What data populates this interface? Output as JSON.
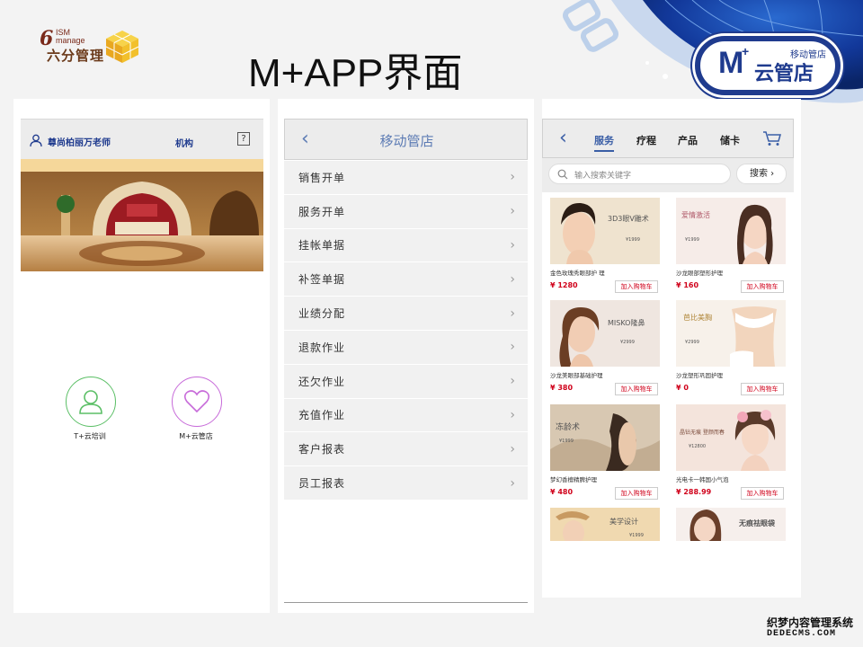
{
  "slide": {
    "title": "M+APP界面",
    "brand": {
      "six": "6",
      "ism": "ISM",
      "manage": "manage",
      "cn": "六分管理"
    },
    "logo": {
      "mark": "M",
      "small": "移动管店",
      "big": "云管店"
    }
  },
  "panel1": {
    "user": "尊尚柏丽万老师",
    "org": "机构",
    "help": "?",
    "apps": [
      {
        "label": "T+云培训",
        "color": "#5bbf66",
        "icon": "person-icon"
      },
      {
        "label": "M+云管店",
        "color": "#c76ad9",
        "icon": "heart-icon"
      }
    ]
  },
  "panel2": {
    "back": "‹",
    "title": "移动管店",
    "menu": [
      "销售开单",
      "服务开单",
      "挂帐单据",
      "补签单据",
      "业绩分配",
      "退款作业",
      "还欠作业",
      "充值作业",
      "客户报表",
      "员工报表"
    ],
    "chevron": "›"
  },
  "panel3": {
    "back": "‹",
    "tabs": [
      "服务",
      "疗程",
      "产品",
      "储卡"
    ],
    "active_tab": "服务",
    "search_placeholder": "输入搜索关键字",
    "search_button": "搜索 ›",
    "add_to_cart": "加入购物车",
    "products": [
      {
        "name": "金色玫瑰秀眼部护 理",
        "price": "¥ 1280",
        "promo": "3D3眼V雕术",
        "promo_price": "¥1999"
      },
      {
        "name": "沙龙眼部塑形护理",
        "price": "¥ 160",
        "promo": "爱情激活",
        "promo_price": "¥1999"
      },
      {
        "name": "沙龙美眼部基础护理",
        "price": "¥ 380",
        "promo": "MISKO隆鼻",
        "promo_price": "¥2999"
      },
      {
        "name": "沙龙塑形巩固护理",
        "price": "¥ 0",
        "promo": "芭比美胸",
        "promo_price": "¥2999"
      },
      {
        "name": "梦幻香檀精脾护理",
        "price": "¥ 480",
        "promo": "冻龄术",
        "promo_price": "¥1999"
      },
      {
        "name": "光电卡一韩国小气泡",
        "price": "¥ 288.99",
        "promo": "晶钻无痕 登颜而春",
        "promo_price": "¥12800"
      },
      {
        "name": "",
        "price": "",
        "promo": "美学设计",
        "promo_price": "¥1999"
      },
      {
        "name": "",
        "price": "",
        "promo": "无痕祛眼袋",
        "promo_price": ""
      }
    ]
  },
  "watermark": {
    "line1": "织梦内容管理系统",
    "line2": "DEDECMS.COM"
  }
}
